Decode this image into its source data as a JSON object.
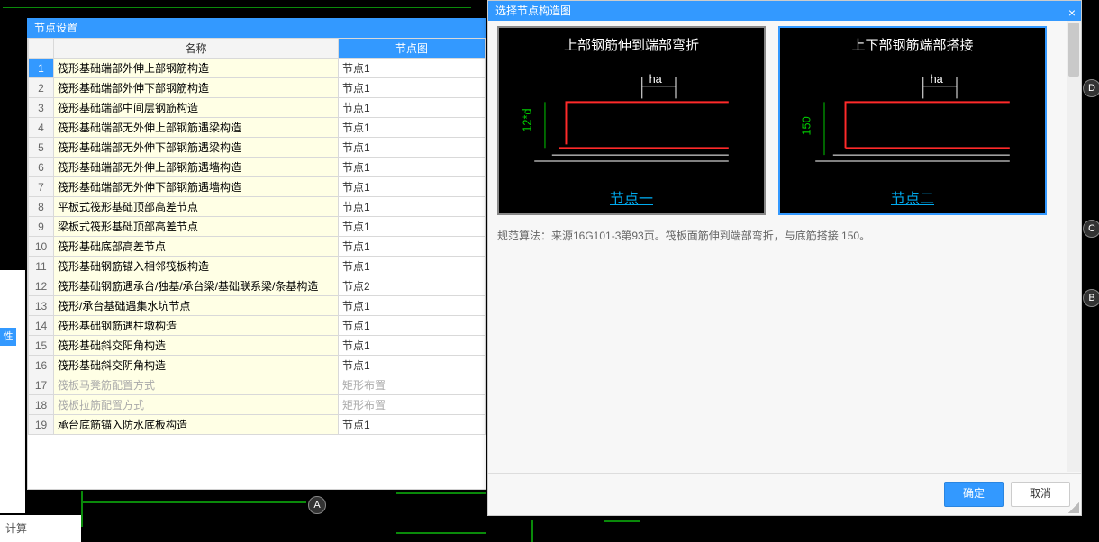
{
  "cad_markers": {
    "A": "A",
    "B": "B",
    "C": "C",
    "D": "D"
  },
  "bottom_label": "计算",
  "left_tab_label": "性值",
  "panel": {
    "title": "节点设置",
    "col_name": "名称",
    "col_node": "节点图",
    "rows": [
      {
        "n": "1",
        "name": "筏形基础端部外伸上部钢筋构造",
        "val": "节点1",
        "sel": true
      },
      {
        "n": "2",
        "name": "筏形基础端部外伸下部钢筋构造",
        "val": "节点1"
      },
      {
        "n": "3",
        "name": "筏形基础端部中间层钢筋构造",
        "val": "节点1"
      },
      {
        "n": "4",
        "name": "筏形基础端部无外伸上部钢筋遇梁构造",
        "val": "节点1"
      },
      {
        "n": "5",
        "name": "筏形基础端部无外伸下部钢筋遇梁构造",
        "val": "节点1"
      },
      {
        "n": "6",
        "name": "筏形基础端部无外伸上部钢筋遇墙构造",
        "val": "节点1"
      },
      {
        "n": "7",
        "name": "筏形基础端部无外伸下部钢筋遇墙构造",
        "val": "节点1"
      },
      {
        "n": "8",
        "name": "平板式筏形基础顶部高差节点",
        "val": "节点1"
      },
      {
        "n": "9",
        "name": "梁板式筏形基础顶部高差节点",
        "val": "节点1"
      },
      {
        "n": "10",
        "name": "筏形基础底部高差节点",
        "val": "节点1"
      },
      {
        "n": "11",
        "name": "筏形基础钢筋锚入相邻筏板构造",
        "val": "节点1"
      },
      {
        "n": "12",
        "name": "筏形基础钢筋遇承台/独基/承台梁/基础联系梁/条基构造",
        "val": "节点2"
      },
      {
        "n": "13",
        "name": "筏形/承台基础遇集水坑节点",
        "val": "节点1"
      },
      {
        "n": "14",
        "name": "筏形基础钢筋遇柱墩构造",
        "val": "节点1"
      },
      {
        "n": "15",
        "name": "筏形基础斜交阳角构造",
        "val": "节点1"
      },
      {
        "n": "16",
        "name": "筏形基础斜交阴角构造",
        "val": "节点1"
      },
      {
        "n": "17",
        "name": "筏板马凳筋配置方式",
        "val": "矩形布置",
        "disabled": true
      },
      {
        "n": "18",
        "name": "筏板拉筋配置方式",
        "val": "矩形布置",
        "disabled": true
      },
      {
        "n": "19",
        "name": "承台底筋锚入防水底板构造",
        "val": "节点1"
      }
    ]
  },
  "dialog": {
    "title": "选择节点构造图",
    "thumb1": {
      "caption": "上部钢筋伸到端部弯折",
      "dim": "12*d",
      "link": "节点一",
      "ha": "ha"
    },
    "thumb2": {
      "caption": "上下部钢筋端部搭接",
      "dim": "150",
      "link": "节点二",
      "ha": "ha"
    },
    "spec": "规范算法：来源16G101-3第93页。筏板面筋伸到端部弯折，与底筋搭接 150。",
    "ok": "确定",
    "cancel": "取消"
  }
}
